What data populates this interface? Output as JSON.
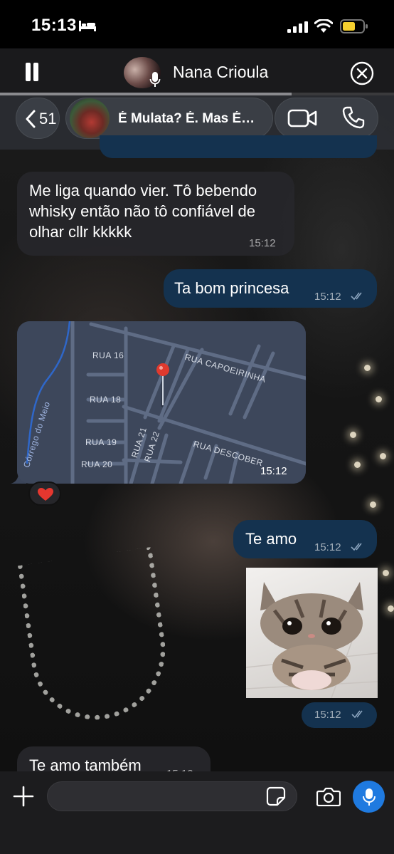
{
  "status_bar": {
    "time": "15:13",
    "battery_color": "#f5d02f"
  },
  "call_banner": {
    "caller_name": "Nana Crioula",
    "progress_fraction": 0.74
  },
  "chat_header": {
    "back_count": "51",
    "group_name": "É Mulata? É. Mas É…"
  },
  "messages": [
    {
      "direction": "in",
      "text": "Me liga quando vier. Tô bebendo whisky então não tô confiável de olhar cllr kkkkk",
      "time": "15:12"
    },
    {
      "direction": "out",
      "text": "Ta bom princesa",
      "time": "15:12"
    },
    {
      "direction": "in",
      "type": "location",
      "map_labels": [
        "RUA 16",
        "RUA CAPOEIRINHA",
        "RUA 18",
        "Córrego do Meio",
        "RUA 21",
        "RUA 22",
        "RUA 19",
        "RUA DESCOBER",
        "RUA 20"
      ],
      "time": "15:12",
      "reaction": "heart"
    },
    {
      "direction": "out",
      "text": "Te amo",
      "time": "15:12"
    },
    {
      "direction": "out",
      "type": "sticker",
      "sticker": "crying-kitten",
      "time": "15:12"
    },
    {
      "direction": "in",
      "text": "Te amo também",
      "time": "15:12"
    }
  ],
  "input": {
    "placeholder": "",
    "value": "",
    "accent_color": "#1f7ae0"
  }
}
